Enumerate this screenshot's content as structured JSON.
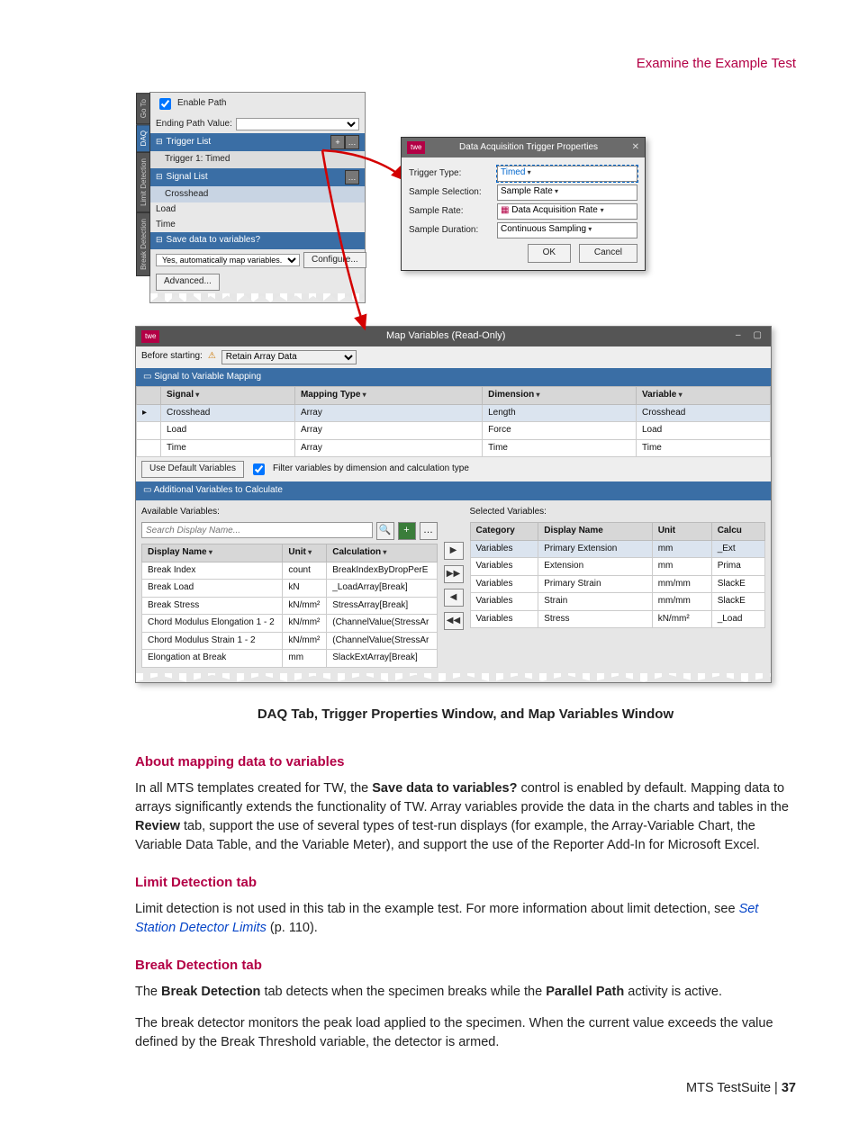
{
  "header": {
    "section_title": "Examine the Example Test"
  },
  "daq_panel": {
    "tabs": [
      "Go To",
      "DAQ",
      "Limit Detection",
      "Break Detection"
    ],
    "enable_path_label": "Enable Path",
    "ending_path_label": "Ending Path Value:",
    "trigger_list_header": "Trigger List",
    "trigger_list_item": "Trigger 1: Timed",
    "signal_list_header": "Signal List",
    "signals": [
      "Crosshead",
      "Load",
      "Time"
    ],
    "save_data_header": "Save data to variables?",
    "save_data_value": "Yes, automatically map variables.",
    "configure_btn": "Configure...",
    "advanced_btn": "Advanced..."
  },
  "trigger_popup": {
    "badge": "twe",
    "title": "Data Acquisition Trigger Properties",
    "rows": {
      "trigger_type": {
        "label": "Trigger Type:",
        "value": "Timed"
      },
      "sample_selection": {
        "label": "Sample Selection:",
        "value": "Sample Rate"
      },
      "sample_rate": {
        "label": "Sample Rate:",
        "value": "Data Acquisition Rate"
      },
      "sample_duration": {
        "label": "Sample Duration:",
        "value": "Continuous Sampling"
      }
    },
    "ok": "OK",
    "cancel": "Cancel"
  },
  "mapvar": {
    "badge": "twe",
    "title": "Map Variables (Read-Only)",
    "before_starting_label": "Before starting:",
    "before_starting_value": "Retain Array Data",
    "sec1": "Signal to Variable Mapping",
    "sec1_cols": [
      "Signal",
      "Mapping Type",
      "Dimension",
      "Variable"
    ],
    "sec1_rows": [
      [
        "Crosshead",
        "Array",
        "Length",
        "Crosshead"
      ],
      [
        "Load",
        "Array",
        "Force",
        "Load"
      ],
      [
        "Time",
        "Array",
        "Time",
        "Time"
      ]
    ],
    "use_defaults_btn": "Use Default Variables",
    "filter_chk": "Filter variables by dimension and calculation type",
    "sec2": "Additional Variables to Calculate",
    "avail_label": "Available Variables:",
    "sel_label": "Selected Variables:",
    "search_placeholder": "Search Display Name...",
    "avail_cols": [
      "Display Name",
      "Unit",
      "Calculation"
    ],
    "avail_rows": [
      [
        "Break Index",
        "count",
        "BreakIndexByDropPerE"
      ],
      [
        "Break Load",
        "kN",
        "_LoadArray[Break]"
      ],
      [
        "Break Stress",
        "kN/mm²",
        "StressArray[Break]"
      ],
      [
        "Chord Modulus Elongation 1 - 2",
        "kN/mm²",
        "(ChannelValue(StressAr"
      ],
      [
        "Chord Modulus Strain 1 - 2",
        "kN/mm²",
        "(ChannelValue(StressAr"
      ],
      [
        "Elongation at Break",
        "mm",
        "SlackExtArray[Break]"
      ]
    ],
    "sel_cols": [
      "Category",
      "Display Name",
      "Unit",
      "Calcu"
    ],
    "sel_rows": [
      [
        "Variables",
        "Primary Extension",
        "mm",
        "_Ext"
      ],
      [
        "Variables",
        "Extension",
        "mm",
        "Prima"
      ],
      [
        "Variables",
        "Primary Strain",
        "mm/mm",
        "SlackE"
      ],
      [
        "Variables",
        "Strain",
        "mm/mm",
        "SlackE"
      ],
      [
        "Variables",
        "Stress",
        "kN/mm²",
        "_Load"
      ]
    ]
  },
  "caption": "DAQ Tab, Trigger Properties Window, and Map Variables Window",
  "body": {
    "h_about": "About mapping data to variables",
    "p_about_1a": "In all MTS templates created for TW, the ",
    "p_about_1b": "Save data to variables?",
    "p_about_1c": " control is enabled by default. Mapping data to arrays significantly extends the functionality of TW. Array variables provide the data in the charts and tables in the ",
    "p_about_1d": "Review",
    "p_about_1e": " tab, support the use of several types of test-run displays (for example, the Array-Variable Chart, the Variable Data Table, and the Variable Meter), and support the use of the Reporter Add-In for Microsoft Excel.",
    "h_limit": "Limit Detection tab",
    "p_limit_a": "Limit detection is not used in this tab in the example test. For more information about limit detection, see ",
    "link_limit": "Set Station Detector Limits",
    "p_limit_b": "  (p. 110).",
    "h_break": "Break Detection tab",
    "p_break1_a": "The ",
    "p_break1_b": "Break Detection",
    "p_break1_c": " tab detects when the specimen breaks while the ",
    "p_break1_d": "Parallel Path",
    "p_break1_e": " activity is active.",
    "p_break2": "The break detector monitors the peak load applied to the specimen. When the current value exceeds the value defined by the Break Threshold variable, the detector is armed."
  },
  "footer": {
    "text": "MTS TestSuite | ",
    "page": "37"
  }
}
